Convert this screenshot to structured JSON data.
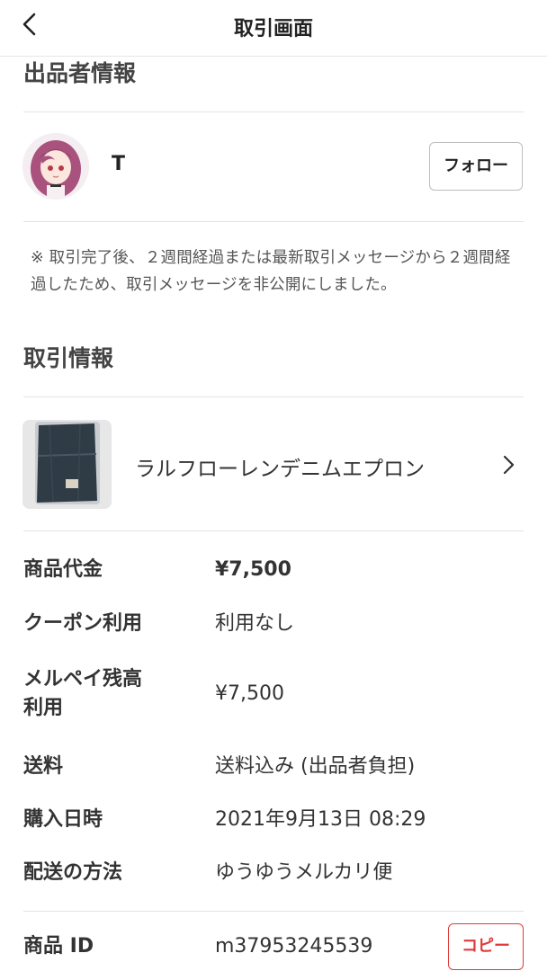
{
  "nav": {
    "title": "取引画面"
  },
  "seller_section": {
    "title": "出品者情報",
    "seller_name": "T",
    "follow_label": "フォロー",
    "notice": "※ 取引完了後、２週間経過または最新取引メッセージから２週間経過したため、取引メッセージを非公開にしました。"
  },
  "trade_section": {
    "title": "取引情報",
    "product": {
      "name": "ラルフローレンデニムエプロン"
    },
    "rows": [
      {
        "label": "商品代金",
        "value": "¥7,500"
      },
      {
        "label": "クーポン利用",
        "value": "利用なし"
      },
      {
        "label": "メルペイ残高\n利用",
        "value": "¥7,500"
      },
      {
        "label": "送料",
        "value": "送料込み (出品者負担)"
      },
      {
        "label": "購入日時",
        "value": "2021年9月13日 08:29"
      },
      {
        "label": "配送の方法",
        "value": "ゆうゆうメルカリ便"
      },
      {
        "label": "商品 ID",
        "value": "m37953245539"
      }
    ],
    "copy_label": "コピー"
  },
  "icons": {
    "back": "chevron-left-icon",
    "product_link": "chevron-right-icon"
  },
  "colors": {
    "accent_red": "#e03a3a",
    "divider": "#e3e3e3",
    "text": "#222222"
  }
}
